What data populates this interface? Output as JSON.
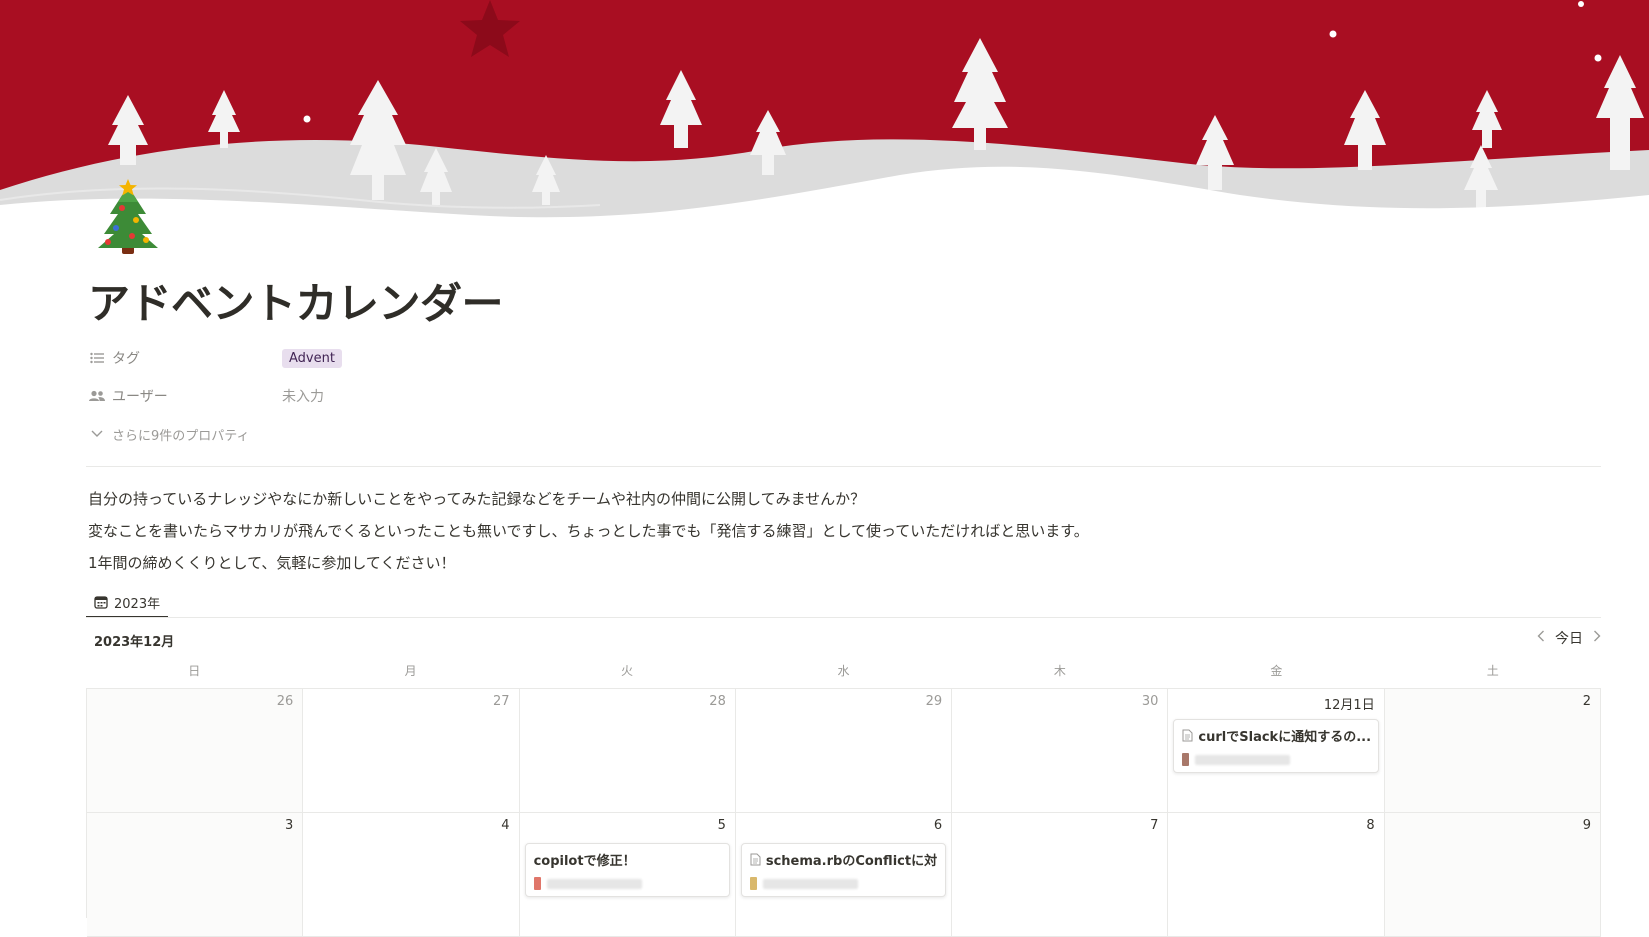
{
  "page": {
    "title": "アドベントカレンダー",
    "emoji": "christmas-tree",
    "cover": "red christmas cover with snowy hills and trees"
  },
  "properties": {
    "tag": {
      "label": "タグ",
      "value": "Advent"
    },
    "user": {
      "label": "ユーザー",
      "value": "未入力"
    },
    "more": "さらに9件のプロパティ"
  },
  "description": [
    "自分の持っているナレッジやなにか新しいことをやってみた記録などをチームや社内の仲間に公開してみませんか？",
    "変なことを書いたらマサカリが飛んでくるといったことも無いですし、ちょっとした事でも「発信する練習」として使っていただければと思います。",
    "1年間の締めくくりとして、気軽に参加してください！"
  ],
  "view": {
    "tab_label": "2023年"
  },
  "calendar": {
    "month_label": "2023年12月",
    "today_label": "今日",
    "weekdays": [
      "日",
      "月",
      "火",
      "水",
      "木",
      "金",
      "土"
    ],
    "weeks": [
      [
        "26",
        "27",
        "28",
        "29",
        "30",
        "12月1日",
        "2"
      ],
      [
        "3",
        "4",
        "5",
        "6",
        "7",
        "8",
        "9"
      ]
    ],
    "events": {
      "fri_dec1": "curlでSlackに通知するの...",
      "tue_dec5": "copilotで修正！",
      "wed_dec6": "schema.rbのConflictに対..."
    }
  },
  "colors": {
    "cover_red": "#ae0f23",
    "tag_bg": "#e8deee",
    "tag_text": "#412454"
  }
}
